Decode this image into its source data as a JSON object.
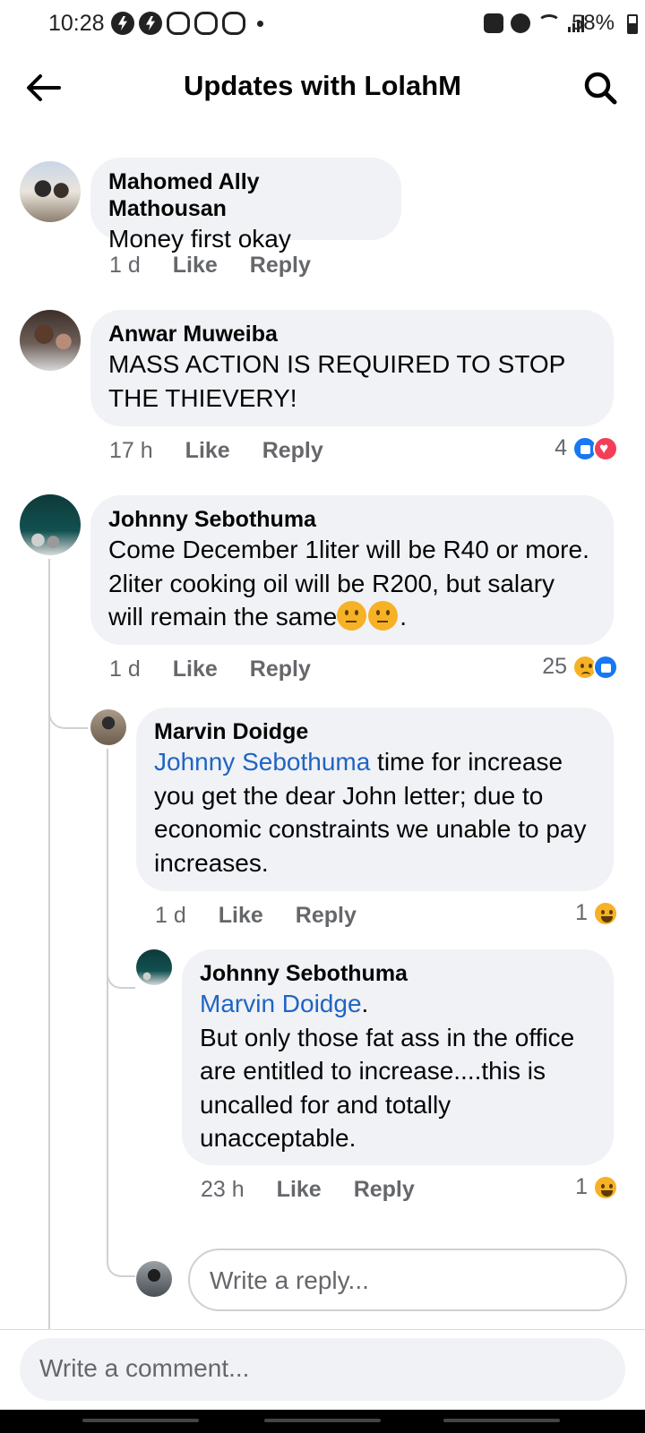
{
  "status_bar": {
    "time": "10:28",
    "battery": "58%"
  },
  "header": {
    "title": "Updates with LolahM"
  },
  "action_labels": {
    "like": "Like",
    "reply": "Reply"
  },
  "comments": [
    {
      "author": "Mahomed Ally Mathousan",
      "text": "Money first okay",
      "time": "1 d"
    },
    {
      "author": "Anwar Muweiba",
      "text": "MASS ACTION IS REQUIRED TO STOP THE THIEVERY!",
      "time": "17 h",
      "reactions": {
        "count": "4",
        "types": [
          "like",
          "love"
        ]
      }
    },
    {
      "author": "Johnny Sebothuma",
      "text": "Come December 1liter will be R40 or more. 2liter cooking oil will be R200, but salary will remain the same",
      "text_end": ".",
      "emojis": [
        "thinking-face",
        "face-with-rolling-eyes"
      ],
      "time": "1 d",
      "reactions": {
        "count": "25",
        "types": [
          "sad",
          "like"
        ]
      }
    }
  ],
  "replies": [
    {
      "author": "Marvin Doidge",
      "mention": "Johnny Sebothuma",
      "text": " time for increase you get the dear John letter; due to economic constraints we unable to pay increases.",
      "time": "1 d",
      "reactions": {
        "count": "1",
        "types": [
          "haha"
        ]
      }
    },
    {
      "author": "Johnny Sebothuma",
      "mention": "Marvin Doidge",
      "mention_suffix": ".",
      "text": "But only those fat ass in the office are entitled to increase....this is uncalled for and totally unacceptable.",
      "time": "23 h",
      "reactions": {
        "count": "1",
        "types": [
          "haha"
        ]
      }
    }
  ],
  "reply_input": {
    "placeholder": "Write a reply..."
  },
  "comment_input": {
    "placeholder": "Write a comment..."
  }
}
